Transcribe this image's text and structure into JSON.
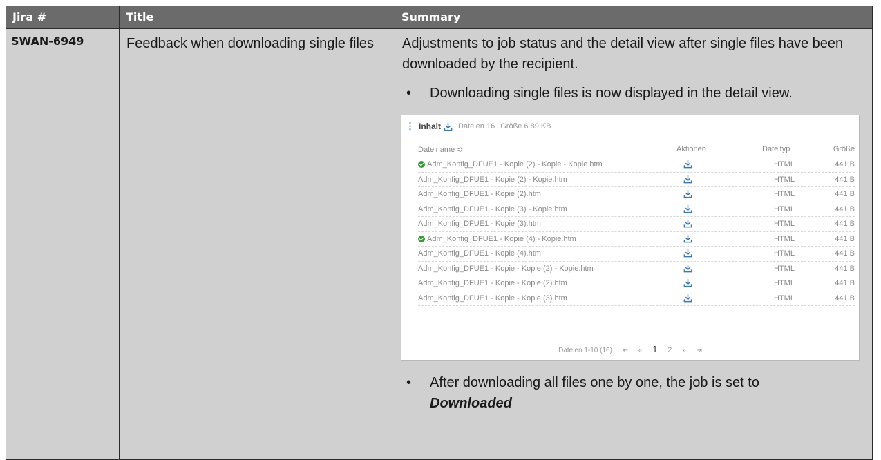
{
  "headers": {
    "jira": "Jira #",
    "title": "Title",
    "summary": "Summary"
  },
  "row": {
    "jira": "SWAN-6949",
    "title": "Feedback when downloading single files",
    "summary_intro": "Adjustments to job status and the detail view after single files have been downloaded by the recipient.",
    "bullet1": "Downloading single files is now displayed in the detail view.",
    "bullet2_text": "After downloading all files one by one, the job is set to",
    "bullet2_emphasis": "Downloaded"
  },
  "screenshot": {
    "kebab": "⋮",
    "section_label": "Inhalt",
    "files_count": "Dateien 16",
    "size_total": "Größe 6.89 KB",
    "columns": {
      "name": "Dateiname ≎",
      "actions": "Aktionen",
      "type": "Dateityp",
      "size": "Größe"
    },
    "rows": [
      {
        "name": "Adm_Konfig_DFUE1 - Kopie (2) - Kopie - Kopie.htm",
        "type": "HTML",
        "size": "441 B",
        "downloaded": true
      },
      {
        "name": "Adm_Konfig_DFUE1 - Kopie (2) - Kopie.htm",
        "type": "HTML",
        "size": "441 B",
        "downloaded": false
      },
      {
        "name": "Adm_Konfig_DFUE1 - Kopie (2).htm",
        "type": "HTML",
        "size": "441 B",
        "downloaded": false
      },
      {
        "name": "Adm_Konfig_DFUE1 - Kopie (3) - Kopie.htm",
        "type": "HTML",
        "size": "441 B",
        "downloaded": false
      },
      {
        "name": "Adm_Konfig_DFUE1 - Kopie (3).htm",
        "type": "HTML",
        "size": "441 B",
        "downloaded": false
      },
      {
        "name": "Adm_Konfig_DFUE1 - Kopie (4) - Kopie.htm",
        "type": "HTML",
        "size": "441 B",
        "downloaded": true
      },
      {
        "name": "Adm_Konfig_DFUE1 - Kopie (4).htm",
        "type": "HTML",
        "size": "441 B",
        "downloaded": false
      },
      {
        "name": "Adm_Konfig_DFUE1 - Kopie - Kopie (2) - Kopie.htm",
        "type": "HTML",
        "size": "441 B",
        "downloaded": false
      },
      {
        "name": "Adm_Konfig_DFUE1 - Kopie - Kopie (2).htm",
        "type": "HTML",
        "size": "441 B",
        "downloaded": false
      },
      {
        "name": "Adm_Konfig_DFUE1 - Kopie - Kopie (3).htm",
        "type": "HTML",
        "size": "441 B",
        "downloaded": false
      }
    ],
    "pager": {
      "range": "Dateien 1-10 (16)",
      "first": "⇤",
      "prev": "«",
      "page1": "1",
      "page2": "2",
      "next": "»",
      "last": "⇥"
    },
    "icons": {
      "download": "download-icon",
      "check": "check-circle-icon"
    },
    "colors": {
      "accent": "#3a78b5",
      "check": "#3a9a3a",
      "header_bg": "#6b6b6b",
      "cell_bg": "#d0d0d0"
    }
  }
}
